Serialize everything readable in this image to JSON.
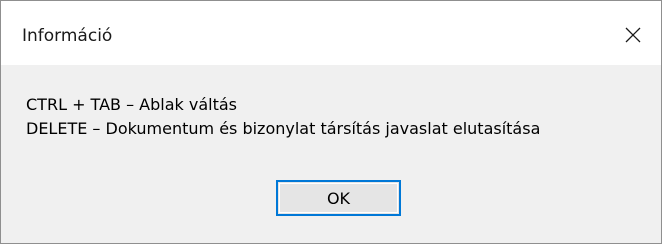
{
  "window": {
    "title": "Információ",
    "close_icon": "close-icon"
  },
  "message": {
    "line1": "CTRL + TAB  –  Ablak váltás",
    "line2": "DELETE  –  Dokumentum és bizonylat társítás javaslat elutasítása"
  },
  "buttons": {
    "ok_label": "OK"
  },
  "colors": {
    "accent": "#0078d7",
    "title_bar_bg": "#ffffff",
    "body_bg": "#f0f0f0",
    "button_bg": "#e5e5e5"
  }
}
